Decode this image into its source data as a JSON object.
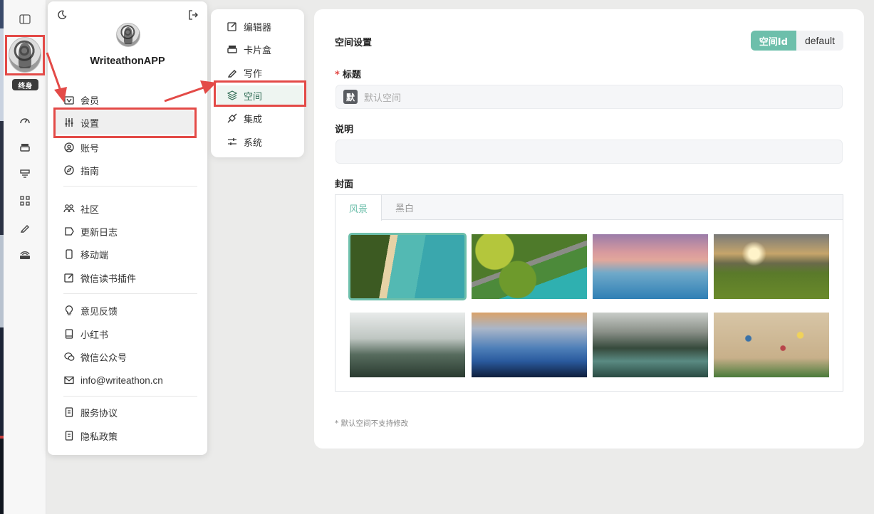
{
  "rail": {
    "badge": "终身",
    "icons": [
      "sidebar-toggle-icon",
      "dashboard-icon",
      "card-box-icon",
      "layers-icon",
      "nodes-icon",
      "pencil-icon",
      "live-icon"
    ]
  },
  "user_menu": {
    "app_name": "WriteathonAPP",
    "items": {
      "member": "会员",
      "settings": "设置",
      "account": "账号",
      "guide": "指南",
      "community": "社区",
      "changelog": "更新日志",
      "mobile": "移动端",
      "wechat_plugin": "微信读书插件",
      "feedback": "意见反馈",
      "xiaohongshu": "小红书",
      "wechat_official": "微信公众号",
      "email": "info@writeathon.cn",
      "terms": "服务协议",
      "privacy": "隐私政策"
    }
  },
  "settings_menu": {
    "editor": "编辑器",
    "card_box": "卡片盒",
    "writing": "写作",
    "space": "空间",
    "integration": "集成",
    "system": "系统"
  },
  "panel": {
    "title": "空间设置",
    "space_id_label": "空间Id",
    "space_id_value": "default",
    "title_label": "标题",
    "title_prefix": "默",
    "title_placeholder": "默认空间",
    "desc_label": "说明",
    "cover_label": "封面",
    "tabs": [
      "风景",
      "黑白"
    ],
    "note": "* 默认空间不支持修改"
  },
  "colors": {
    "accent": "#6dbfab",
    "highlight": "#e34a47"
  }
}
